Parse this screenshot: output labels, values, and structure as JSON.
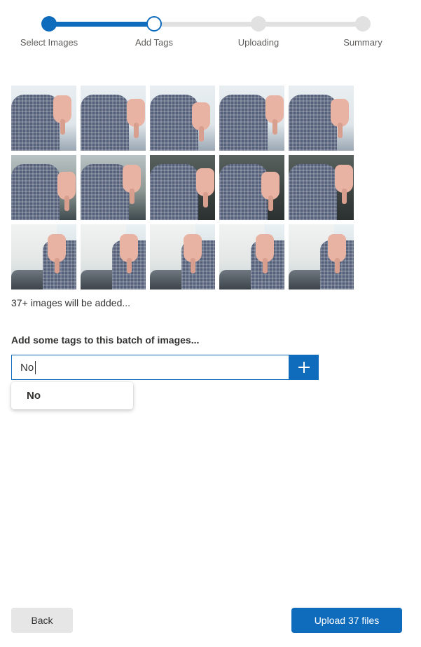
{
  "stepper": {
    "steps": [
      {
        "label": "Select Images",
        "state": "done"
      },
      {
        "label": "Add Tags",
        "state": "current"
      },
      {
        "label": "Uploading",
        "state": "pending"
      },
      {
        "label": "Summary",
        "state": "pending"
      }
    ],
    "accent_color": "#0f6cbd",
    "inactive_color": "#e1e1e1"
  },
  "images": {
    "thumbnails": [
      {
        "subject": "man in checked shirt giving thumbs down"
      },
      {
        "subject": "man in checked shirt giving thumbs down"
      },
      {
        "subject": "man in checked shirt giving thumbs down"
      },
      {
        "subject": "man in checked shirt giving thumbs down"
      },
      {
        "subject": "man in checked shirt giving thumbs down"
      },
      {
        "subject": "man in checked shirt giving thumbs down"
      },
      {
        "subject": "man in checked shirt giving thumbs down"
      },
      {
        "subject": "man in dim light giving thumbs down"
      },
      {
        "subject": "man in dim light giving thumbs down"
      },
      {
        "subject": "man in dim light giving thumbs down"
      },
      {
        "subject": "arm giving thumbs down in meeting room"
      },
      {
        "subject": "arm giving thumbs down in meeting room"
      },
      {
        "subject": "arm giving thumbs down in meeting room"
      },
      {
        "subject": "arm giving thumbs down in meeting room"
      },
      {
        "subject": "arm giving thumbs down in meeting room"
      }
    ],
    "count_text": "37+ images will be added..."
  },
  "tags": {
    "heading": "Add some tags to this batch of images...",
    "input_value": "No",
    "suggestions": [
      "No"
    ]
  },
  "footer": {
    "back_label": "Back",
    "upload_label": "Upload 37 files"
  }
}
